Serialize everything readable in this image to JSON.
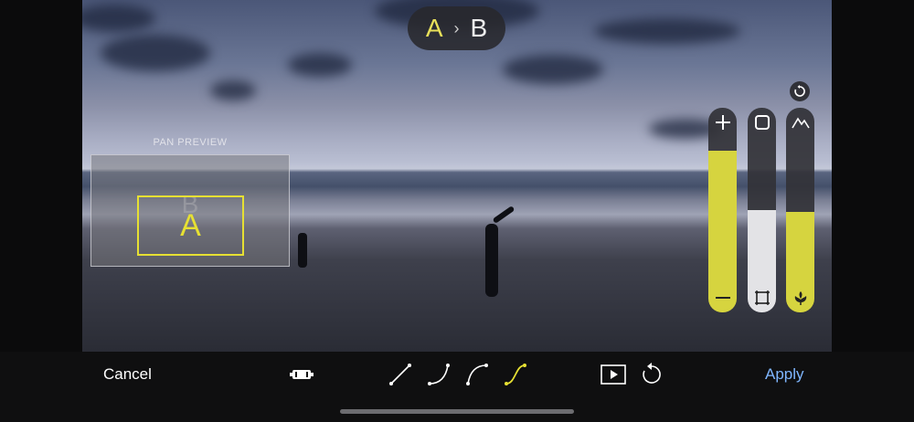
{
  "ab_indicator": {
    "a": "A",
    "separator": "›",
    "b": "B"
  },
  "pan_preview": {
    "label": "PAN PREVIEW",
    "start_letter": "A",
    "end_letter": "B"
  },
  "sliders": [
    {
      "name": "zoom",
      "top_icon": "plus-icon",
      "bottom_icon": "minus-icon",
      "level": 0.79,
      "fill_color": "#d6d43f"
    },
    {
      "name": "frame",
      "top_icon": "square-icon",
      "bottom_icon": "crop-frame-icon",
      "level": 0.5,
      "fill_color": "#e3e3e6"
    },
    {
      "name": "focus",
      "top_icon": "mountain-icon",
      "bottom_icon": "flower-icon",
      "level": 0.49,
      "fill_color": "#d6d43f"
    }
  ],
  "toolbar": {
    "cancel_label": "Cancel",
    "apply_label": "Apply",
    "curve_options": [
      "linear",
      "ease-in",
      "ease-out",
      "ease-in-out"
    ],
    "selected_curve": "ease-in-out"
  },
  "colors": {
    "accent_yellow": "#e6e033",
    "apply_blue": "#7fb6ff"
  }
}
